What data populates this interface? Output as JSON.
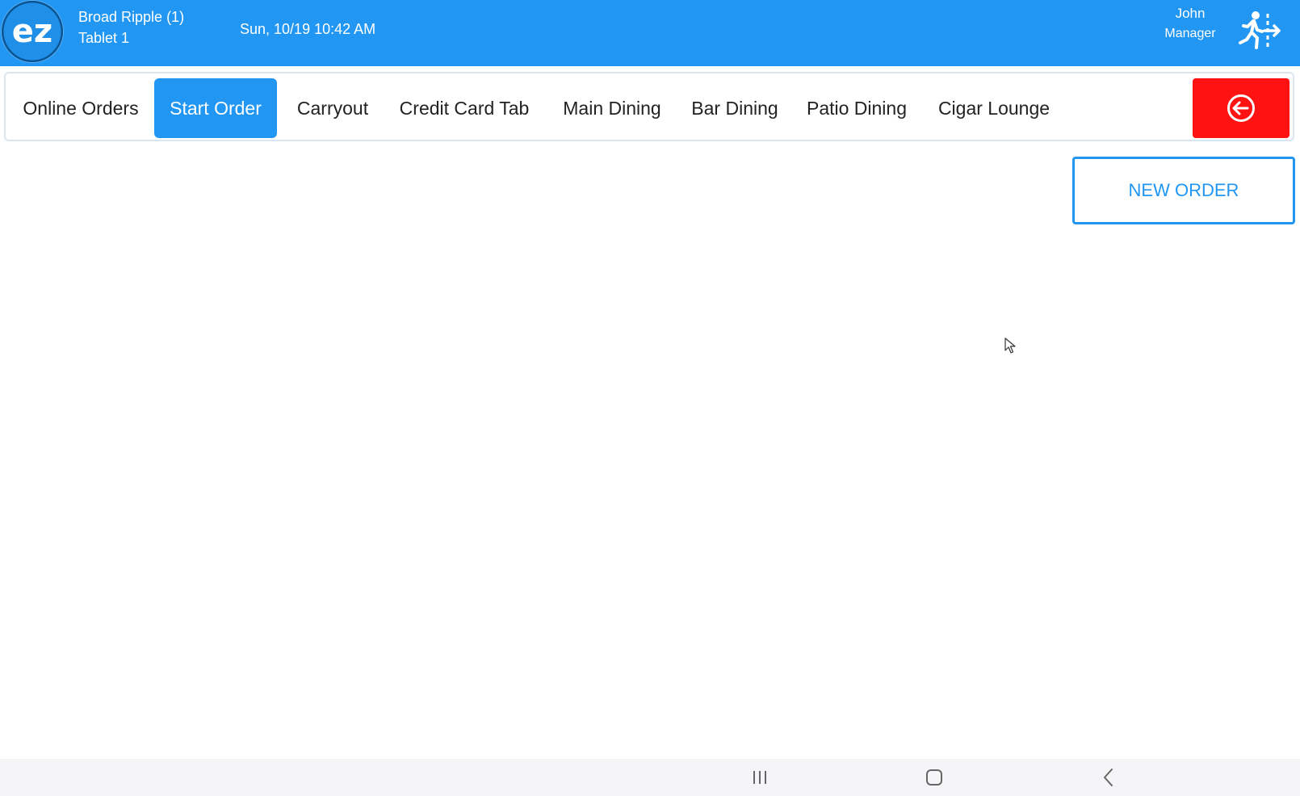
{
  "header": {
    "logo_text": "ez",
    "location": "Broad Ripple (1)",
    "device": "Tablet 1",
    "datetime": "Sun, 10/19 10:42 AM",
    "user_name": "John",
    "user_role": "Manager",
    "logout_icon": "exit-running-icon",
    "background_color": "#2196f3"
  },
  "tabs": [
    {
      "label": "Online Orders",
      "active": false
    },
    {
      "label": "Start Order",
      "active": true
    },
    {
      "label": "Carryout",
      "active": false
    },
    {
      "label": "Credit Card Tab",
      "active": false
    },
    {
      "label": "Main Dining",
      "active": false
    },
    {
      "label": "Bar Dining",
      "active": false
    },
    {
      "label": "Patio Dining",
      "active": false
    },
    {
      "label": "Cigar Lounge",
      "active": false
    }
  ],
  "back_button": {
    "icon": "circle-arrow-left-icon",
    "color": "#ff1212"
  },
  "new_order": {
    "label": "NEW ORDER"
  },
  "system_nav": {
    "recents_icon": "recents-icon",
    "home_icon": "home-icon",
    "back_icon": "back-chevron-icon"
  }
}
